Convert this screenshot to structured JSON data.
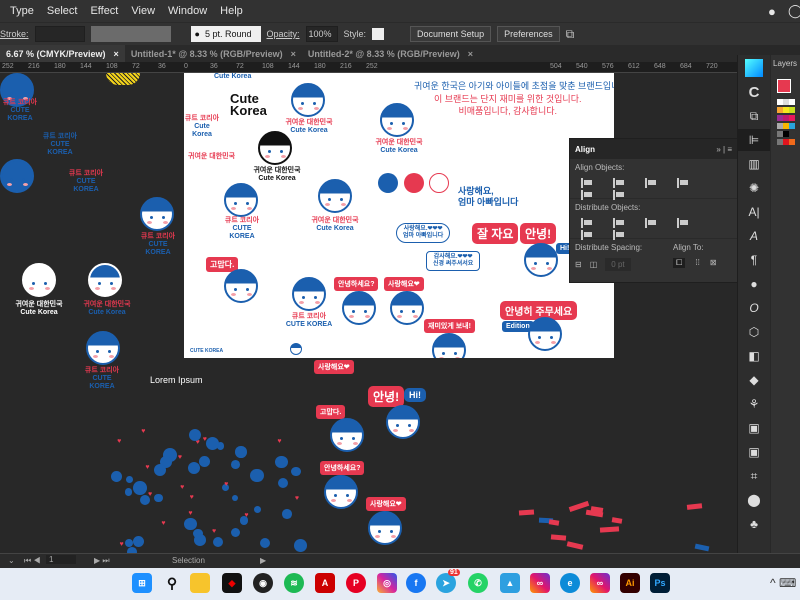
{
  "menu": [
    "Type",
    "Select",
    "Effect",
    "View",
    "Window",
    "Help"
  ],
  "control": {
    "stroke_label": "Stroke:",
    "brush": "5 pt. Round",
    "opacity_label": "Opacity:",
    "opacity": "100%",
    "style_label": "Style:",
    "doc_setup": "Document Setup",
    "preferences": "Preferences"
  },
  "tabs": [
    {
      "label": "6.67 % (CMYK/Preview)",
      "close": "×"
    },
    {
      "label": "Untitled-1* @ 8.33 % (RGB/Preview)",
      "close": "×"
    },
    {
      "label": "Untitled-2* @ 8.33 % (RGB/Preview)",
      "close": "×"
    }
  ],
  "ruler": [
    "252",
    "216",
    "180",
    "144",
    "108",
    "72",
    "36",
    "0",
    "36",
    "72",
    "108",
    "144",
    "180",
    "216",
    "252",
    "504",
    "540",
    "576",
    "612",
    "648",
    "684",
    "720"
  ],
  "artboard": {
    "cute_korea_top": "Cute Korea",
    "logo_line1": "Cute",
    "logo_line2": "Korea",
    "kr_cute": "귀여운 대한민국",
    "en_cute": "Cute Korea",
    "kr_kyute": "큐트 코리아",
    "en_kyute": "CUTE KOREA",
    "headline1": "귀여운 한국은 아기와 아이들에 초점을 맞춘 브랜드입니다.",
    "headline2": "이 브랜드는 단지 재미를 위한 것입니다.",
    "headline3": "비매품입니다, 감사합니다.",
    "love1": "사랑해요,",
    "love2": "엄마 아빠입니다",
    "bubble_love_1": "사랑해요.❤❤❤",
    "bubble_love_2": "엄마 아빠입니다",
    "bubble_thanks_1": "감사해요.❤❤❤",
    "bubble_thanks_2": "신경 써주셔서요",
    "sleep": "잘 자요",
    "hello": "안녕!",
    "hi": "Hi!",
    "thanks": "고맙다.",
    "hello_q": "안녕하세요?",
    "love_heart": "사랑해요❤",
    "have_fun": "재미있게 보내!",
    "goodnight": "안녕히 주무세요",
    "edition": "Edition",
    "small_brand": "CUTE KOREA"
  },
  "canvas": {
    "lorem": "Lorem Ipsum"
  },
  "align": {
    "title": "Align",
    "align_objects": "Align Objects:",
    "distribute_objects": "Distribute Objects:",
    "distribute_spacing": "Distribute Spacing:",
    "align_to": "Align To:",
    "spacing_value": "0 pt"
  },
  "layers": {
    "title": "Layers"
  },
  "status": {
    "page": "1",
    "tool": "Selection"
  },
  "taskbar": {
    "telegram_badge": "91",
    "ai": "Ai",
    "ps": "Ps"
  },
  "colors": {
    "brand_blue": "#1b5fae",
    "brand_red": "#e63950"
  }
}
